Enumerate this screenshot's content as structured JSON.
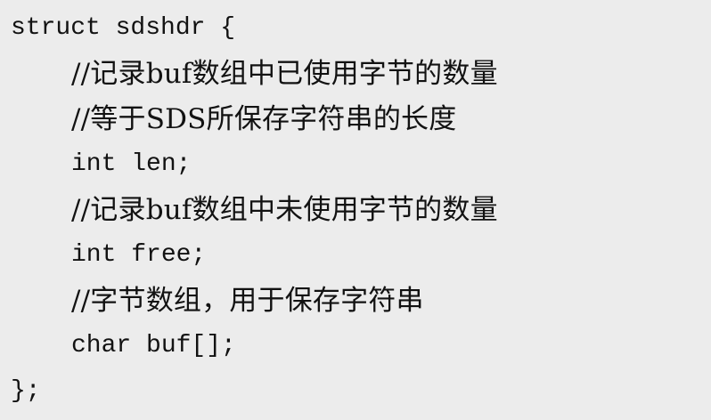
{
  "code": {
    "lines": [
      "struct sdshdr {",
      "//记录buf数组中已使用字节的数量",
      "//等于SDS所保存字符串的长度",
      "int len;",
      "//记录buf数组中未使用字节的数量",
      "int free;",
      "//字节数组，用于保存字符串",
      "char buf[];",
      "};"
    ]
  }
}
